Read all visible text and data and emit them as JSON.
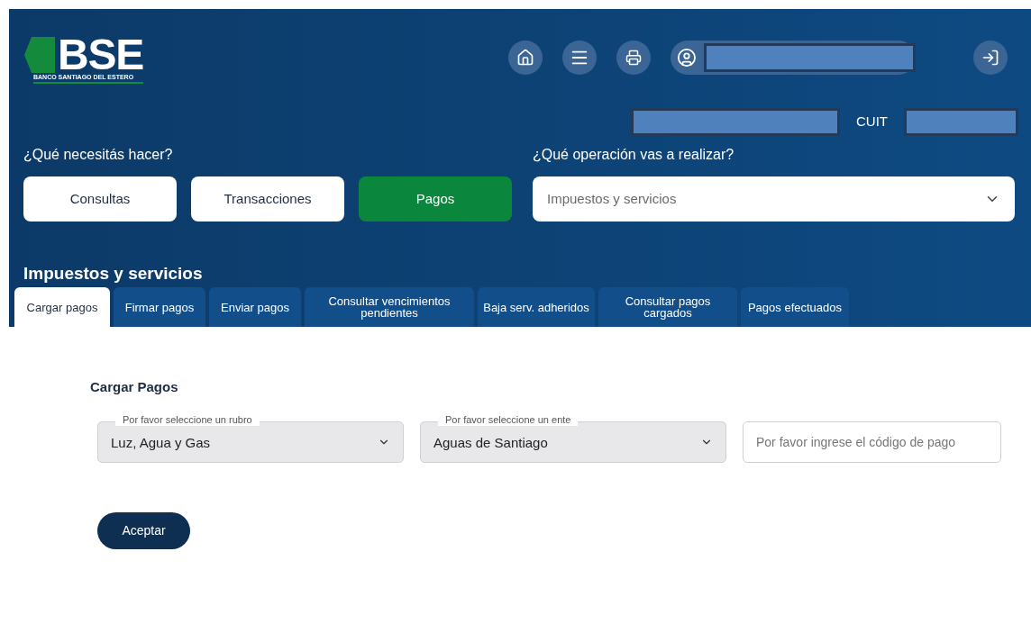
{
  "header": {
    "logo": {
      "letters": "BSE",
      "subtitle": "BANCO SANTIAGO DEL ESTERO"
    },
    "cuit_label": "CUIT"
  },
  "need_label": "¿Qué necesitás hacer?",
  "categories": [
    {
      "label": "Consultas",
      "selected": false
    },
    {
      "label": "Transacciones",
      "selected": false
    },
    {
      "label": "Pagos",
      "selected": true
    }
  ],
  "operation": {
    "label": "¿Qué operación vas a realizar?",
    "value": "Impuestos y servicios"
  },
  "section_title": "Impuestos y servicios",
  "tabs": [
    {
      "label": "Cargar pagos",
      "selected": true
    },
    {
      "label": "Firmar pagos",
      "selected": false
    },
    {
      "label": "Enviar pagos",
      "selected": false
    },
    {
      "label": "Consultar vencimientos pendientes",
      "selected": false
    },
    {
      "label": "Baja serv. adheridos",
      "selected": false
    },
    {
      "label": "Consultar pagos cargados",
      "selected": false
    },
    {
      "label": "Pagos efectuados",
      "selected": false
    }
  ],
  "form": {
    "title": "Cargar Pagos",
    "fields": [
      {
        "kind": "select",
        "label": "Por favor seleccione un rubro",
        "value": "Luz, Agua y Gas"
      },
      {
        "kind": "select",
        "label": "Por favor seleccione un ente",
        "value": "Aguas de Santiago"
      },
      {
        "kind": "input",
        "placeholder": "Por favor ingrese el código de pago"
      }
    ],
    "submit": "Aceptar"
  }
}
